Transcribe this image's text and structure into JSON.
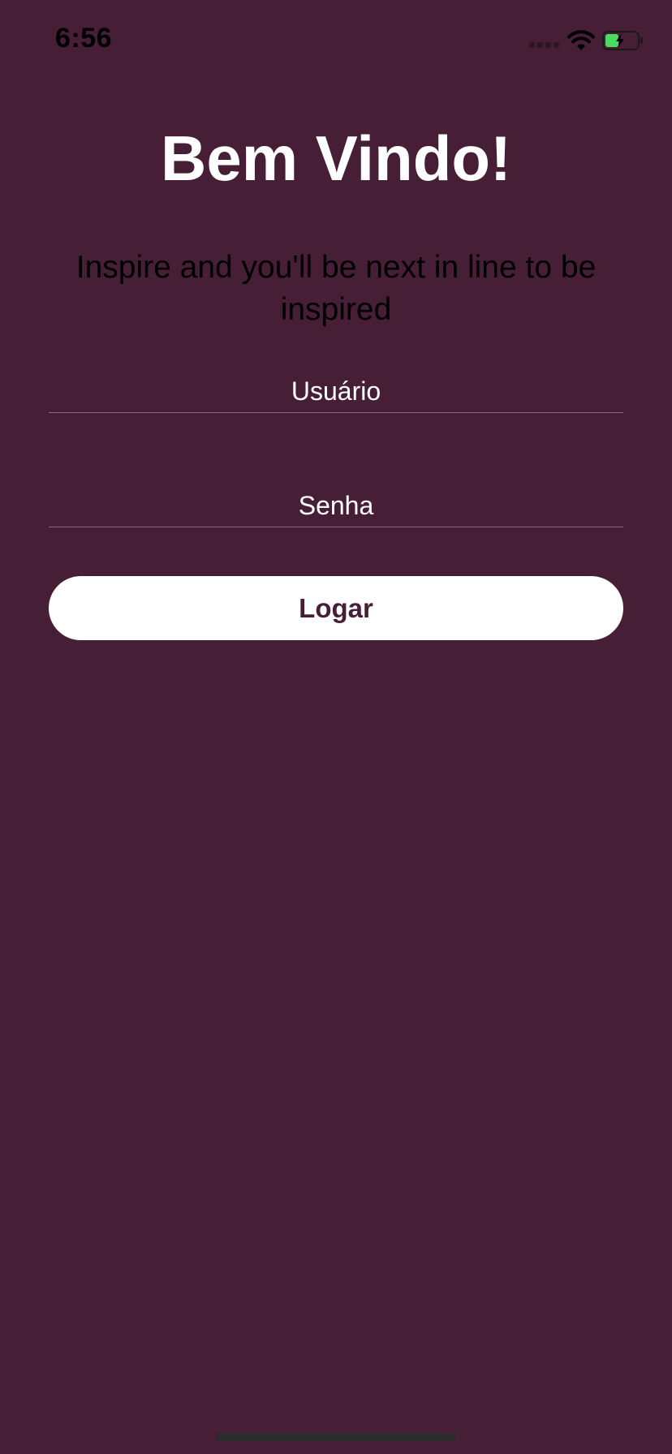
{
  "status_bar": {
    "time": "6:56",
    "icons": [
      "signal-icon",
      "wifi-icon",
      "battery-charging-icon"
    ]
  },
  "colors": {
    "background": "#461f37",
    "title": "#ffffff",
    "tagline": "#000000",
    "button_background": "#ffffff",
    "button_text": "#461f37",
    "battery_fill": "#4cd964"
  },
  "welcome": {
    "title": "Bem Vindo!",
    "tagline": "Inspire and you'll be next in line to be inspired"
  },
  "form": {
    "username": {
      "placeholder": "Usuário",
      "value": ""
    },
    "password": {
      "placeholder": "Senha",
      "value": ""
    },
    "login_label": "Logar"
  }
}
